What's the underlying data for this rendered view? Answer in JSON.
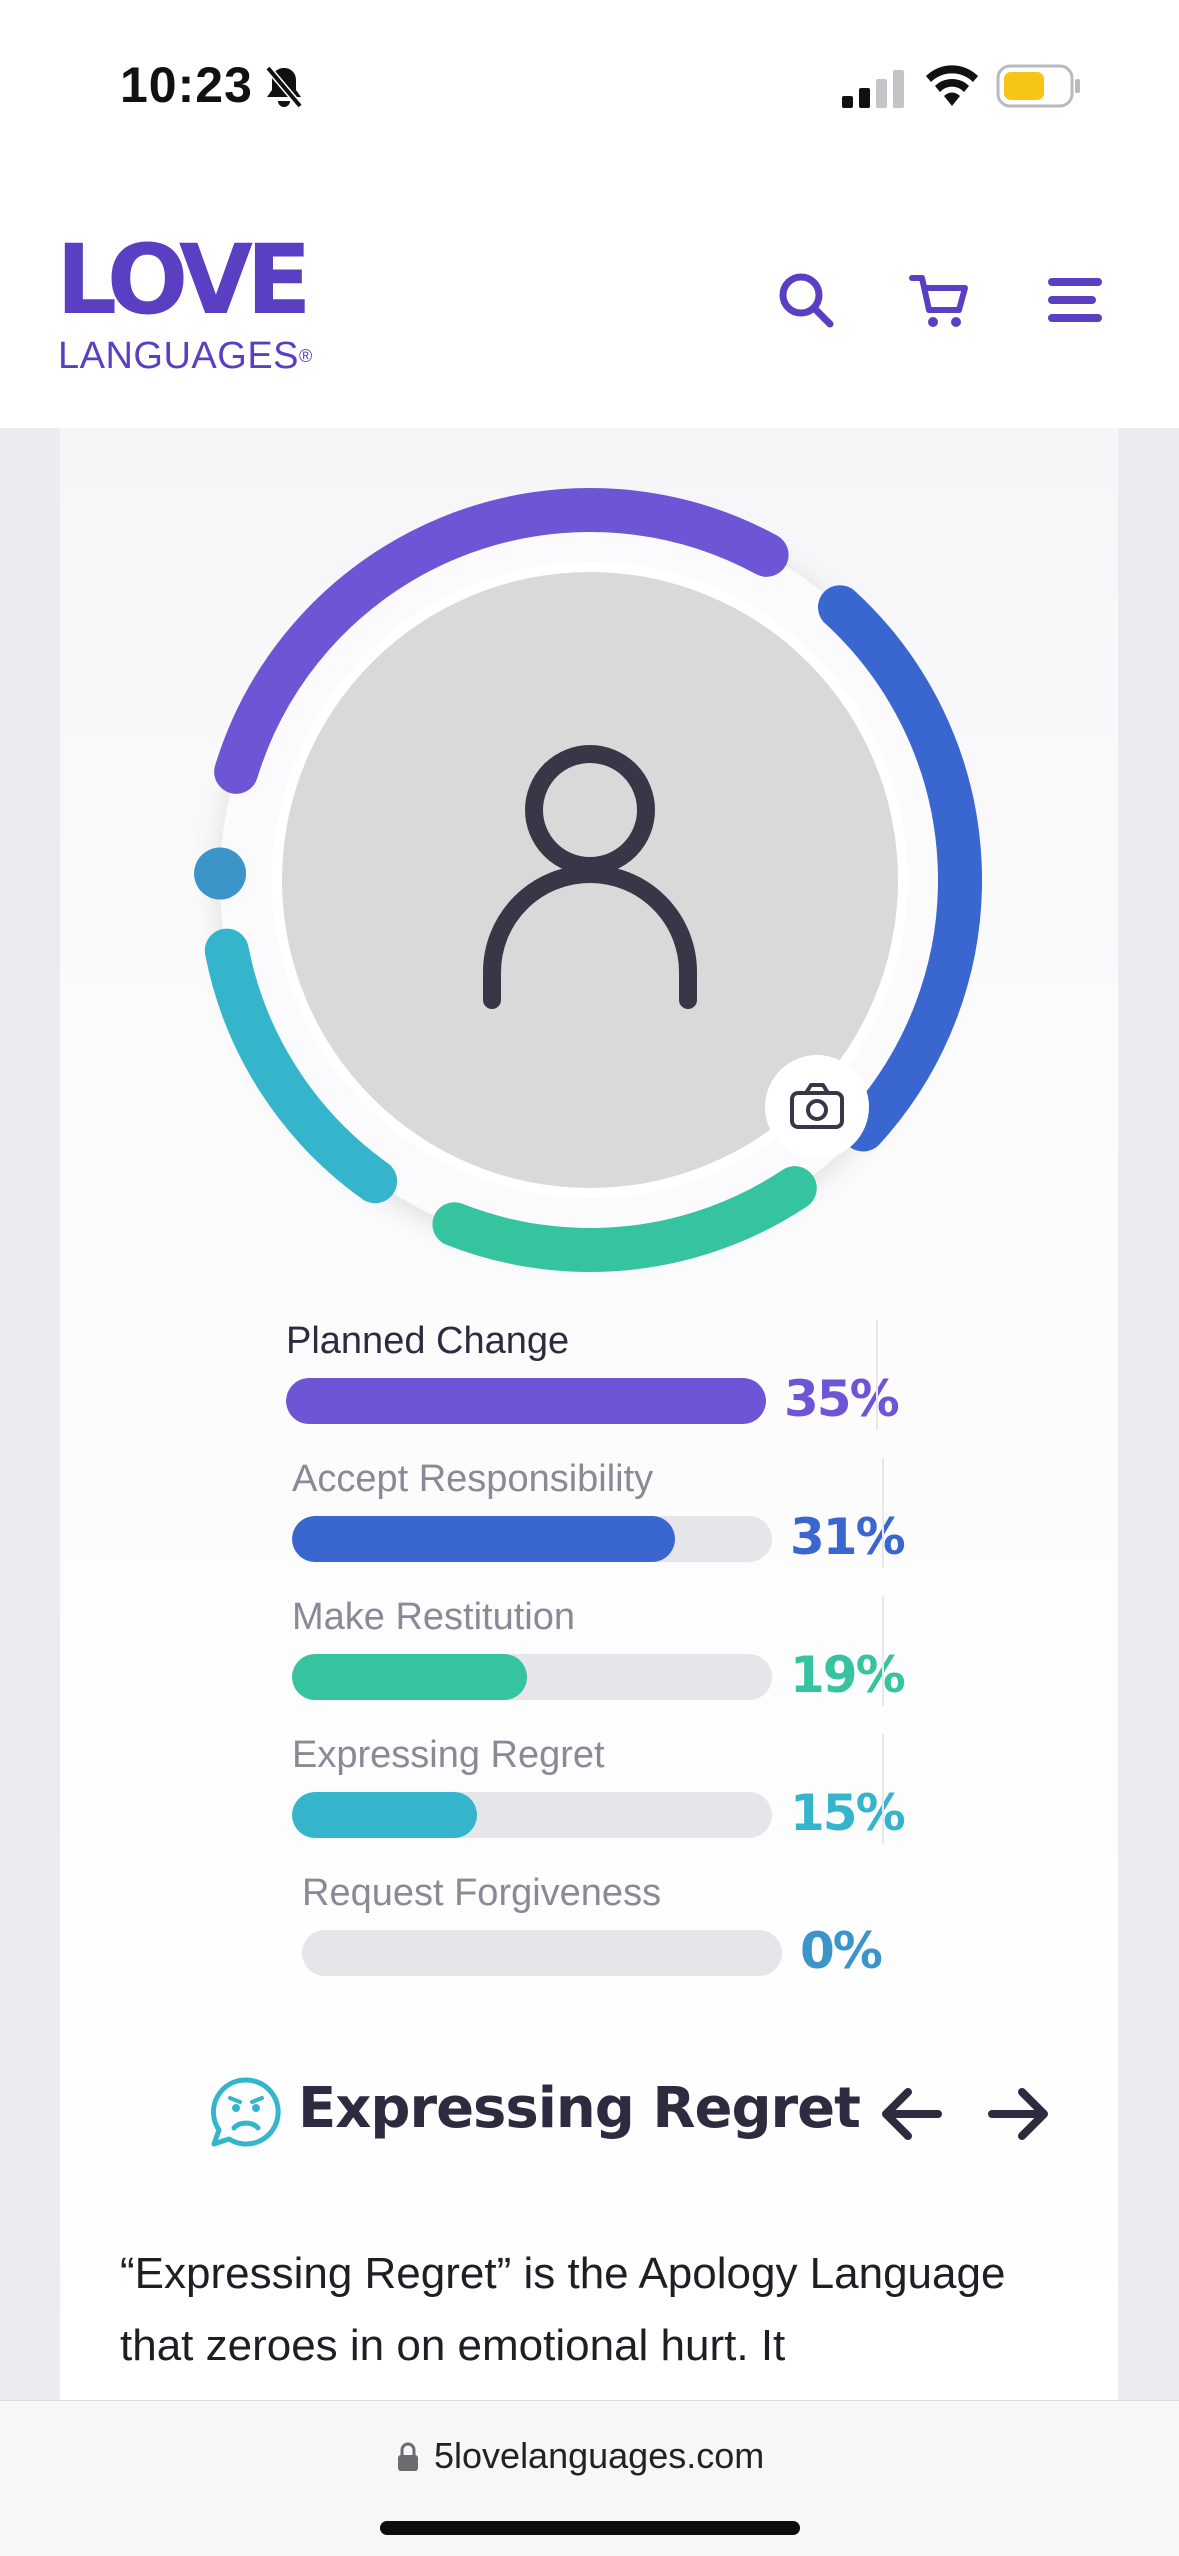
{
  "status": {
    "time": "10:23"
  },
  "brand": {
    "line1": "LOVE",
    "line2": "LANGUAGES",
    "mark": "®",
    "color": "#5b3fc3"
  },
  "header": {
    "icons": [
      "search-icon",
      "cart-icon",
      "menu-icon"
    ]
  },
  "profile": {
    "avatar": "person-icon",
    "camera": "camera-icon"
  },
  "results": [
    {
      "label": "Planned Change",
      "percent": 35,
      "pct_label": "35%",
      "color": "#6e55d6"
    },
    {
      "label": "Accept Responsibility",
      "percent": 31,
      "pct_label": "31%",
      "color": "#3966cf"
    },
    {
      "label": "Make Restitution",
      "percent": 19,
      "pct_label": "19%",
      "color": "#36c3a0"
    },
    {
      "label": "Expressing Regret",
      "percent": 15,
      "pct_label": "15%",
      "color": "#35b5cb"
    },
    {
      "label": "Request Forgiveness",
      "percent": 0,
      "pct_label": "0%",
      "color": "#3b95c9"
    }
  ],
  "section": {
    "title": "Expressing Regret",
    "icon": "sad-face-bubble-icon",
    "prev": "arrow-left-icon",
    "next": "arrow-right-icon",
    "description": "“Expressing Regret” is the Apology Language that zeroes in on emotional hurt. It"
  },
  "browser": {
    "url": "5lovelanguages.com",
    "lock": "lock-icon"
  }
}
